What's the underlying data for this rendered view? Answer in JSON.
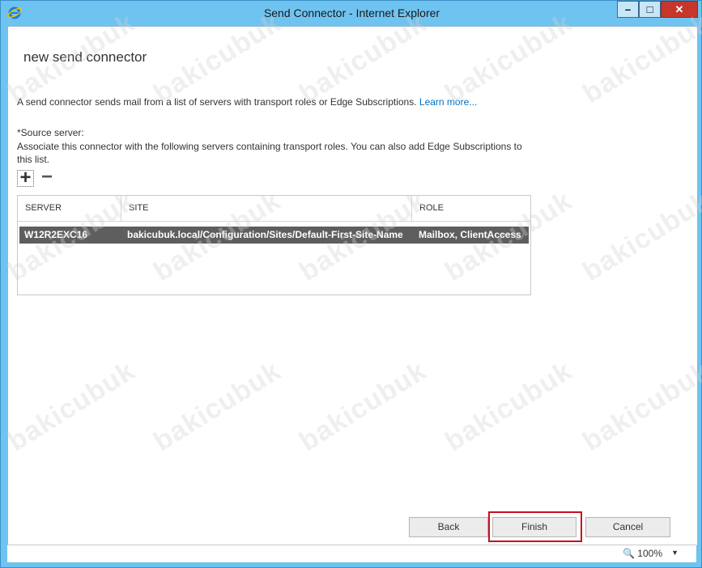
{
  "window": {
    "title": "Send Connector - Internet Explorer",
    "controls": {
      "minimize": "–",
      "maximize": "□",
      "close": "✕"
    }
  },
  "page": {
    "heading": "new send connector",
    "description": "A send connector sends mail from a list of servers with transport roles or Edge Subscriptions.",
    "learn_more": "Learn more...",
    "source_server_label": "*Source server:",
    "source_server_help": "Associate this connector with the following servers containing transport roles. You can also add Edge Subscriptions to this list.",
    "toolbar": {
      "add": "+",
      "remove": "−"
    },
    "table": {
      "columns": [
        "SERVER",
        "SITE",
        "ROLE"
      ],
      "rows": [
        {
          "server": "W12R2EXC16",
          "site": "bakicubuk.local/Configuration/Sites/Default-First-Site-Name",
          "role": "Mailbox, ClientAccess"
        }
      ]
    },
    "buttons": {
      "back": "Back",
      "finish": "Finish",
      "cancel": "Cancel"
    }
  },
  "statusbar": {
    "zoom": "100%"
  },
  "watermark": "bakicubuk",
  "colors": {
    "frame": "#6fc3f0",
    "close_button": "#c7362b",
    "selected_row": "#5e5e5e",
    "link": "#0072c6",
    "highlight": "#c8101e"
  }
}
